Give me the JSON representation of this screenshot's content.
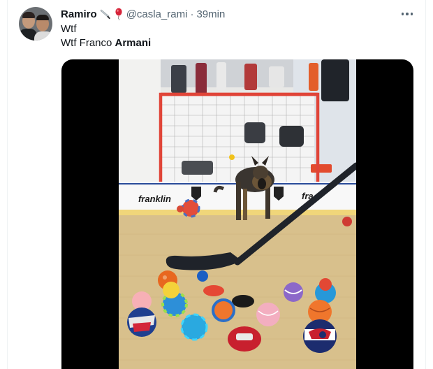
{
  "tweet": {
    "display_name": "Ramiro",
    "emojis": [
      "knife-icon",
      "balloon-icon"
    ],
    "handle": "@casla_rami",
    "separator": "·",
    "time": "39min",
    "text_line1": "Wtf",
    "text_line2_prefix": "Wtf Franco ",
    "text_line2_bold": "Armani"
  },
  "video_content": {
    "board_texts": [
      "franklin",
      "fra"
    ],
    "colors": {
      "goal_frame": "#e04438",
      "floor": "#d8c08c",
      "stick": "#1f232a",
      "background_black": "#000000"
    }
  }
}
